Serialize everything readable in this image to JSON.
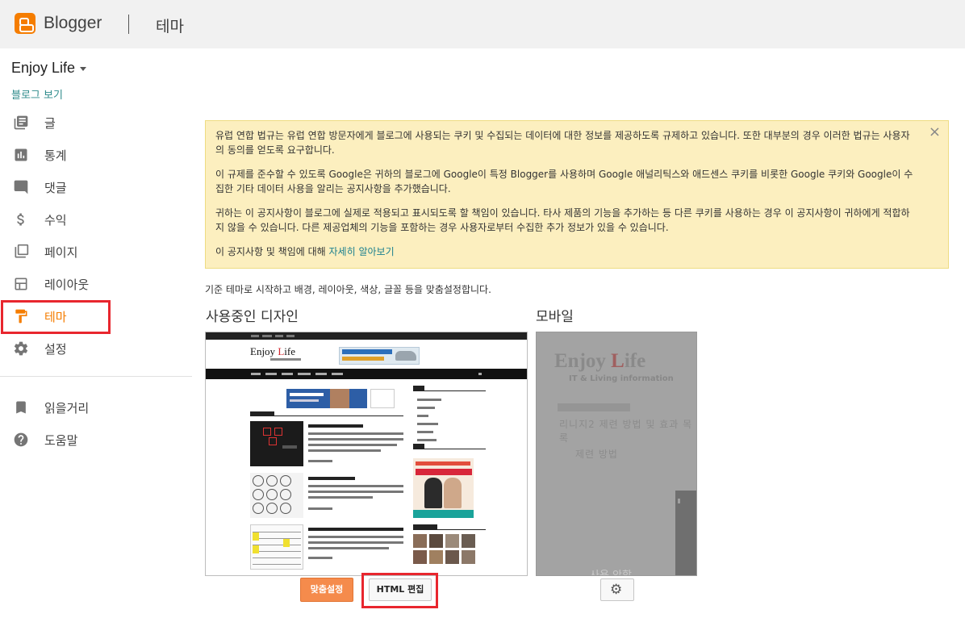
{
  "app": {
    "brand": "Blogger",
    "page_title": "테마"
  },
  "sidebar": {
    "blog_name": "Enjoy Life",
    "view_blog": "블로그 보기",
    "items": [
      {
        "label": "글",
        "icon": "posts-icon"
      },
      {
        "label": "통계",
        "icon": "stats-icon"
      },
      {
        "label": "댓글",
        "icon": "comments-icon"
      },
      {
        "label": "수익",
        "icon": "dollar-icon"
      },
      {
        "label": "페이지",
        "icon": "pages-icon"
      },
      {
        "label": "레이아웃",
        "icon": "layout-icon"
      },
      {
        "label": "테마",
        "icon": "theme-icon",
        "active": true
      },
      {
        "label": "설정",
        "icon": "gear-icon"
      }
    ],
    "items2": [
      {
        "label": "읽을거리",
        "icon": "bookmark-icon"
      },
      {
        "label": "도움말",
        "icon": "help-icon"
      }
    ]
  },
  "notice": {
    "p1": "유럽 연합 법규는 유럽 연합 방문자에게 블로그에 사용되는 쿠키 및 수집되는 데이터에 대한 정보를 제공하도록 규제하고 있습니다. 또한 대부분의 경우 이러한 법규는 사용자의 동의를 얻도록 요구합니다.",
    "p2": "이 규제를 준수할 수 있도록 Google은 귀하의 블로그에 Google이 특정 Blogger를 사용하며 Google 애널리틱스와 애드센스 쿠키를 비롯한 Google 쿠키와 Google이 수집한 기타 데이터 사용을 알리는 공지사항을 추가했습니다.",
    "p3": "귀하는 이 공지사항이 블로그에 실제로 적용되고 표시되도록 할 책임이 있습니다. 타사 제품의 기능을 추가하는 등 다른 쿠키를 사용하는 경우 이 공지사항이 귀하에게 적합하지 않을 수 있습니다. 다른 제공업체의 기능을 포함하는 경우 사용자로부터 수집한 추가 정보가 있을 수 있습니다.",
    "p4_prefix": "이 공지사항 및 책임에 대해 ",
    "p4_link": "자세히 알아보기",
    "close": "×"
  },
  "main": {
    "intro": "기준 테마로 시작하고 배경, 레이아웃, 색상, 글꼴 등을 맞춤설정합니다.",
    "current_heading": "사용중인 디자인",
    "mobile_heading": "모바일"
  },
  "preview": {
    "logo_a": "Enjoy ",
    "logo_b": "L",
    "logo_c": "ife"
  },
  "mobile": {
    "title_a": "Enjoy ",
    "title_b": "L",
    "title_c": "ife",
    "subtitle": "IT & Living information",
    "post_title": "리니지2 제련 방법 및 효과 목록",
    "section": "제련 방법",
    "bottom_text": "사용 안함"
  },
  "buttons": {
    "customize": "맞춤설정",
    "edit_html": "HTML 편집"
  },
  "colors": {
    "brand_orange": "#f57d00",
    "highlight_red": "#e8262e",
    "notice_bg": "#fcefbf",
    "link_teal": "#1a7f8e"
  }
}
